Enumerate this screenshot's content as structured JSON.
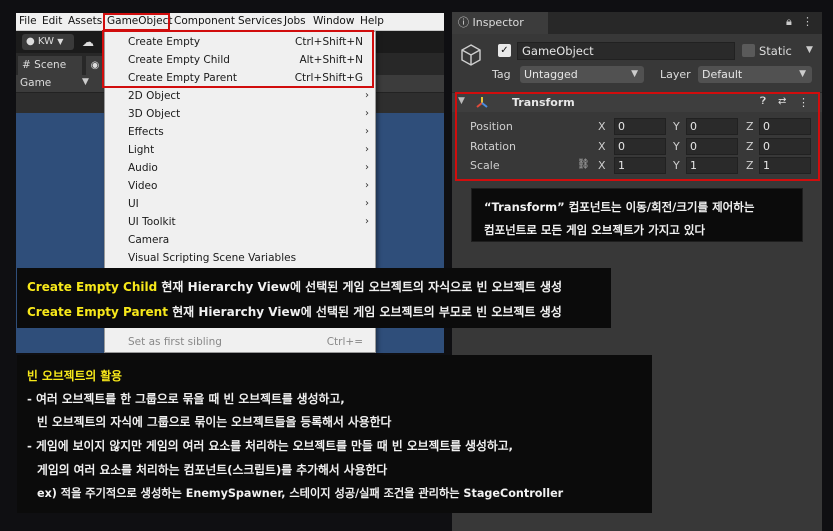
{
  "menubar": {
    "items": [
      "File",
      "Edit",
      "Assets",
      "GameObject",
      "Component",
      "Services",
      "Jobs",
      "Window",
      "Help"
    ]
  },
  "toolbar": {
    "account": "KW"
  },
  "scene": {
    "tab_label": "Scene",
    "game_label": "Game"
  },
  "dropdown": {
    "items": [
      {
        "label": "Create Empty",
        "shortcut": "Ctrl+Shift+N"
      },
      {
        "label": "Create Empty Child",
        "shortcut": "Alt+Shift+N"
      },
      {
        "label": "Create Empty Parent",
        "shortcut": "Ctrl+Shift+G"
      },
      {
        "label": "2D Object"
      },
      {
        "label": "3D Object"
      },
      {
        "label": "Effects"
      },
      {
        "label": "Light"
      },
      {
        "label": "Audio"
      },
      {
        "label": "Video"
      },
      {
        "label": "UI"
      },
      {
        "label": "UI Toolkit"
      },
      {
        "label": "Camera"
      },
      {
        "label": "Visual Scripting Scene Variables"
      },
      {
        "label": "Set as first sibling",
        "shortcut": "Ctrl+="
      }
    ]
  },
  "inspector": {
    "tab_label": "Inspector",
    "object_name": "GameObject",
    "static_label": "Static",
    "tag_label": "Tag",
    "tag_value": "Untagged",
    "layer_label": "Layer",
    "layer_value": "Default",
    "transform": {
      "title": "Transform",
      "rows": [
        {
          "label": "Position",
          "x": "0",
          "y": "0",
          "z": "0"
        },
        {
          "label": "Rotation",
          "x": "0",
          "y": "0",
          "z": "0"
        },
        {
          "label": "Scale",
          "x": "1",
          "y": "1",
          "z": "1"
        }
      ],
      "axes": [
        "X",
        "Y",
        "Z"
      ]
    }
  },
  "notes": {
    "transform": [
      "“Transform” 컴포넌트는 이동/회전/크기를 제어하는",
      "컴포넌트로 모든 게임 오브젝트가 가지고 있다"
    ],
    "create": [
      {
        "keyword": "Create Empty Child",
        "text": " 현재 Hierarchy View에 선택된 게임 오브젝트의 자식으로 빈 오브젝트 생성"
      },
      {
        "keyword": "Create Empty Parent",
        "text": " 현재 Hierarchy View에 선택된 게임 오브젝트의 부모로 빈 오브젝트 생성"
      }
    ],
    "empty_title": "빈 오브젝트의 활용",
    "empty_lines": [
      "- 여러 오브젝트를 한 그룹으로 묶을 때 빈 오브젝트를 생성하고,",
      "빈 오브젝트의 자식에 그룹으로 묶이는 오브젝트들을 등록해서 사용한다",
      "- 게임에 보이지 않지만 게임의 여러 요소를 처리하는 오브젝트를 만들 때 빈 오브젝트를 생성하고,",
      "게임의 여러 요소를 처리하는 컴포넌트(스크립트)를 추가해서 사용한다",
      "ex) 적을 주기적으로 생성하는 EnemySpawner, 스테이지 성공/실패 조건을 관리하는 StageController"
    ]
  },
  "colors": {
    "highlight_border": "#d10d0d",
    "keyword_yellow": "#f7e81a",
    "scene_blue": "#2f4e7a"
  }
}
